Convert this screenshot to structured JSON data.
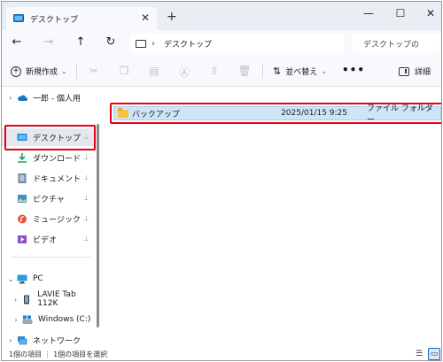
{
  "tab": {
    "title": "デスクトップ",
    "close": "✕",
    "new": "+"
  },
  "window_controls": {
    "minimize": "—",
    "maximize": "☐",
    "close": "✕"
  },
  "nav": {
    "back": "←",
    "forward": "→",
    "up": "↑",
    "refresh": "↻"
  },
  "address": {
    "separator": "›",
    "location": "デスクトップ"
  },
  "search": {
    "placeholder": "デスクトップの"
  },
  "toolbar": {
    "new_label": "新規作成",
    "sort_label": "並べ替え",
    "more_label": "•••",
    "details_label": "詳細"
  },
  "sidebar": {
    "items": [
      {
        "label": "一郎 - 個人用",
        "expander": "›",
        "icon": "cloud-icon"
      },
      {
        "label": "デスクトップ",
        "pin": "📌",
        "icon": "desktop-icon"
      },
      {
        "label": "ダウンロード",
        "pin": "📌",
        "icon": "download-icon"
      },
      {
        "label": "ドキュメント",
        "pin": "📌",
        "icon": "document-icon"
      },
      {
        "label": "ピクチャ",
        "pin": "📌",
        "icon": "pictures-icon"
      },
      {
        "label": "ミュージック",
        "pin": "📌",
        "icon": "music-icon"
      },
      {
        "label": "ビデオ",
        "pin": "📌",
        "icon": "video-icon"
      },
      {
        "label": "PC",
        "expander": "⌄",
        "icon": "pc-icon"
      },
      {
        "label": "LAVIE Tab 112K",
        "expander": "›",
        "icon": "tablet-icon"
      },
      {
        "label": "Windows (C:)",
        "expander": "›",
        "icon": "drive-icon"
      },
      {
        "label": "ネットワーク",
        "expander": "›",
        "icon": "network-icon"
      }
    ]
  },
  "files": [
    {
      "name": "バックアップ",
      "date": "2025/01/15 9:25",
      "type": "ファイル フォルダー"
    }
  ],
  "status": {
    "count": "1個の項目",
    "selected": "1個の項目を選択"
  },
  "colors": {
    "highlight": "#e60012",
    "selection": "#cde5f7",
    "accent": "#0a64c8"
  }
}
